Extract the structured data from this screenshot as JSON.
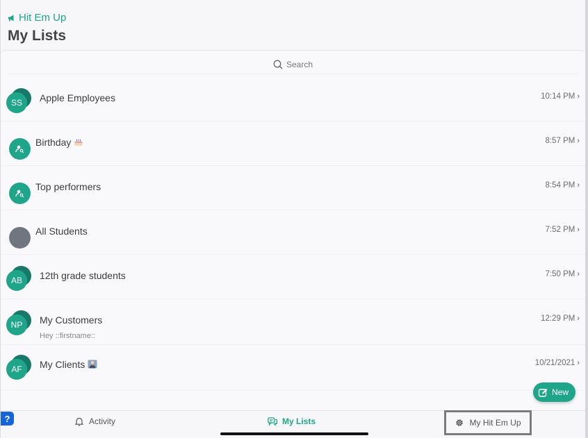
{
  "header": {
    "back_label": "Hit Em Up",
    "title": "My Lists"
  },
  "search": {
    "placeholder": "Search"
  },
  "lists": [
    {
      "title": "Apple Employees",
      "time": "10:14 PM",
      "avatar_type": "stack",
      "initials": "SS",
      "subtitle": ""
    },
    {
      "title": "Birthday",
      "time": "8:57 PM",
      "avatar_type": "person",
      "emoji": "cake-icon",
      "subtitle": ""
    },
    {
      "title": "Top performers",
      "time": "8:54 PM",
      "avatar_type": "person",
      "subtitle": ""
    },
    {
      "title": "All Students",
      "time": "7:52 PM",
      "avatar_type": "empty",
      "subtitle": ""
    },
    {
      "title": "12th grade students",
      "time": "7:50 PM",
      "avatar_type": "stack",
      "initials": "AB",
      "subtitle": ""
    },
    {
      "title": "My Customers",
      "time": "12:29 PM",
      "avatar_type": "stack",
      "initials": "NP",
      "subtitle": "Hey ::firstname::"
    },
    {
      "title": "My Clients",
      "time": "10/21/2021",
      "avatar_type": "stack",
      "initials": "AF",
      "emoji": "business-person-icon",
      "subtitle": ""
    }
  ],
  "new_button": {
    "label": "New"
  },
  "tabs": {
    "activity": "Activity",
    "my_lists": "My Lists",
    "settings": "My Hit Em Up"
  },
  "help": {
    "label": "?"
  },
  "colors": {
    "accent": "#1fa58a",
    "accent_dark": "#17796a",
    "avatar_gray": "#6f7680",
    "help_blue": "#1565d8"
  }
}
